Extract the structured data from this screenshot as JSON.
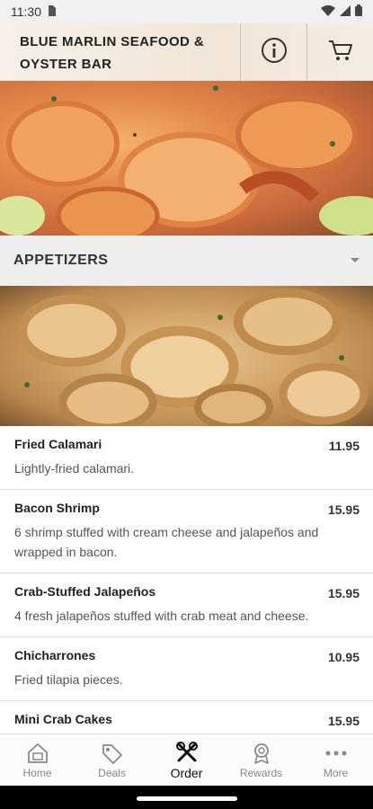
{
  "status": {
    "time": "11:30"
  },
  "header": {
    "title": "BLUE MARLIN SEAFOOD &\nOYSTER BAR"
  },
  "category": {
    "title": "APPETIZERS"
  },
  "menu": {
    "items": [
      {
        "name": "Fried Calamari",
        "price": "11.95",
        "description": "Lightly-fried calamari."
      },
      {
        "name": "Bacon Shrimp",
        "price": "15.95",
        "description": "6 shrimp stuffed with cream cheese and jalapeños and wrapped in bacon."
      },
      {
        "name": "Crab-Stuffed Jalapeños",
        "price": "15.95",
        "description": "4 fresh jalapeños stuffed with crab meat and cheese."
      },
      {
        "name": "Chicharrones",
        "price": "10.95",
        "description": "Fried tilapia pieces."
      },
      {
        "name": "Mini Crab Cakes",
        "price": "15.95",
        "description": ""
      }
    ]
  },
  "nav": {
    "home": "Home",
    "deals": "Deals",
    "order": "Order",
    "rewards": "Rewards",
    "more": "More"
  },
  "colors": {
    "accent": "#111111",
    "inactive": "#888888",
    "category_bg": "#eeeeee"
  }
}
